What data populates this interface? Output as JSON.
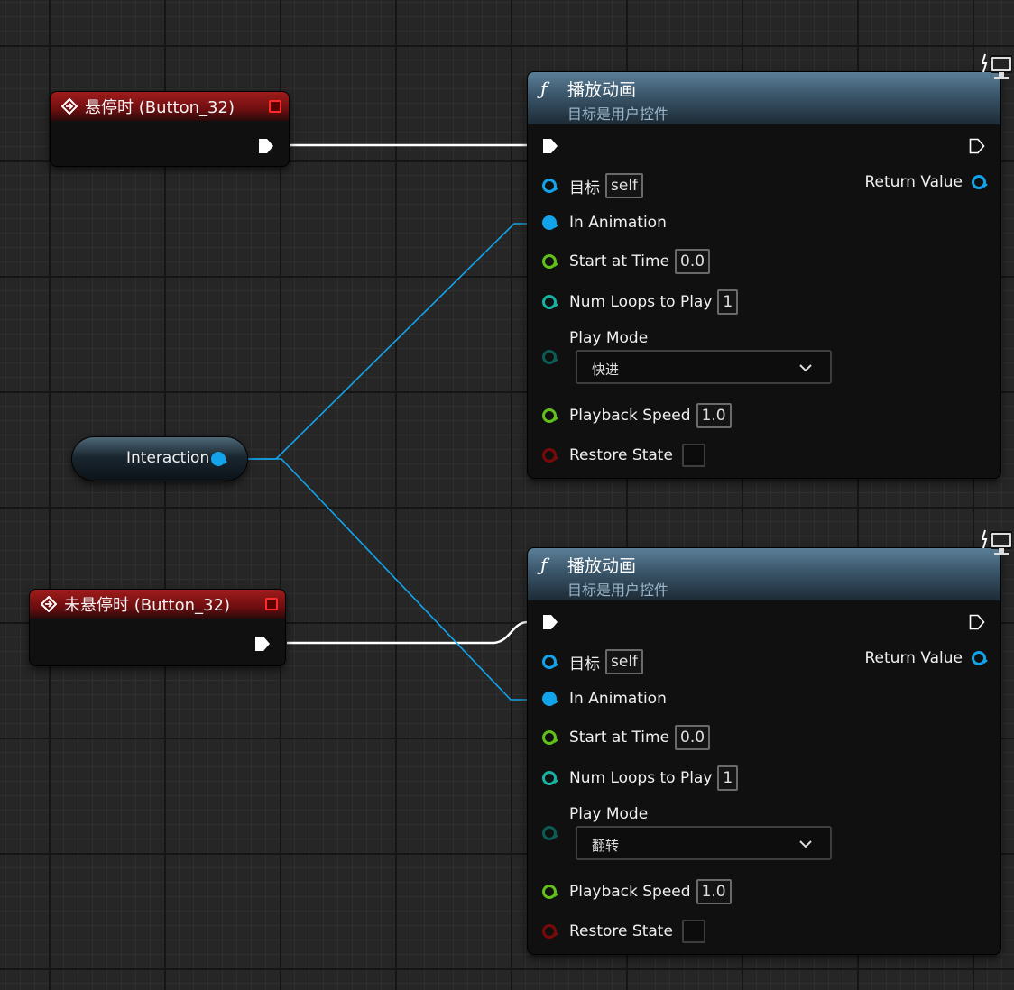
{
  "event_nodes": [
    {
      "title": "悬停时 (Button_32)",
      "header_color": "#8b1414"
    },
    {
      "title": "未悬停时 (Button_32)",
      "header_color": "#8b1414"
    }
  ],
  "variable_node": {
    "label": "Interaction"
  },
  "function_nodes": [
    {
      "title": "播放动画",
      "subtitle": "目标是用户控件",
      "target_label": "目标",
      "target_value": "self",
      "return_value_label": "Return Value",
      "in_animation_label": "In Animation",
      "start_at_time_label": "Start at Time",
      "start_at_time_value": "0.0",
      "num_loops_label": "Num Loops to Play",
      "num_loops_value": "1",
      "play_mode_label": "Play Mode",
      "play_mode_value": "快进",
      "playback_speed_label": "Playback Speed",
      "playback_speed_value": "1.0",
      "restore_state_label": "Restore State"
    },
    {
      "title": "播放动画",
      "subtitle": "目标是用户控件",
      "target_label": "目标",
      "target_value": "self",
      "return_value_label": "Return Value",
      "in_animation_label": "In Animation",
      "start_at_time_label": "Start at Time",
      "start_at_time_value": "0.0",
      "num_loops_label": "Num Loops to Play",
      "num_loops_value": "1",
      "play_mode_label": "Play Mode",
      "play_mode_value": "翻转",
      "playback_speed_label": "Playback Speed",
      "playback_speed_value": "1.0",
      "restore_state_label": "Restore State"
    }
  ],
  "colors": {
    "object_pin": "#12a3ea",
    "float_pin": "#61c11a",
    "int_pin": "#15b3a2",
    "bool_pin": "#7a0a0a",
    "exec_wire": "#ffffff",
    "object_wire": "#12a3ea"
  }
}
